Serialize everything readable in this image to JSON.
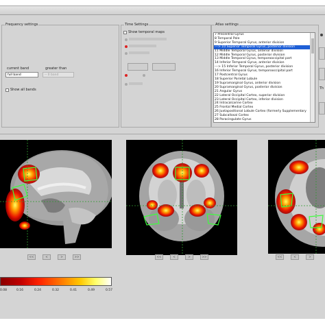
{
  "freq": {
    "title": "Frequency settings",
    "current_band_label": "current band",
    "greater_than_label": "greater than",
    "current_band_value": "full band",
    "greater_than_value": "-- 0 band",
    "show_all_bands": "Show all bands"
  },
  "time": {
    "title": "Time Settings",
    "show_temporal_maps": "Show temporal maps"
  },
  "atlas": {
    "title": "Atlas settings",
    "items": [
      "7 Precentral Gyrus",
      "8 Temporal Pole",
      "9 Superior Temporal Gyrus, anterior division",
      "---> 10 Superior Temporal Gyrus, posterior division",
      "11 Middle Temporal Gyrus, anterior division",
      "12 Middle Temporal Gyrus, posterior division",
      "13 Middle Temporal Gyrus, temporooccipital part",
      "14 Inferior Temporal Gyrus, anterior division",
      "---> 15 Inferior Temporal Gyrus, posterior division",
      "16 Inferior Temporal Gyrus, temporooccipital part",
      "17 Postcentral Gyrus",
      "18 Superior Parietal Lobule",
      "19 Supramarginal Gyrus, anterior division",
      "20 Supramarginal Gyrus, posterior division",
      "21 Angular Gyrus",
      "22 Lateral Occipital Cortex, superior division",
      "23 Lateral Occipital Cortex, inferior division",
      "24 Intracalcarine Cortex",
      "25 Frontal Medial Cortex",
      "26 Juxtapositional Lobule Cortex (formerly Supplementary",
      "27 Subcallosal Cortex",
      "28 Paracingulate Gyrus"
    ],
    "highlighted_index": 3
  },
  "right_panel": {
    "item_label": "Th"
  },
  "nav": {
    "first": "<<",
    "prev": "<",
    "next": ">",
    "last": ">>"
  },
  "colorbar": {
    "ticks": [
      "0.08",
      "0.16",
      "0.24",
      "0.32",
      "0.41",
      "0.49",
      "0.57"
    ],
    "colors": [
      "#8a0000",
      "#ff2200",
      "#ffc800",
      "#ffffff"
    ]
  }
}
